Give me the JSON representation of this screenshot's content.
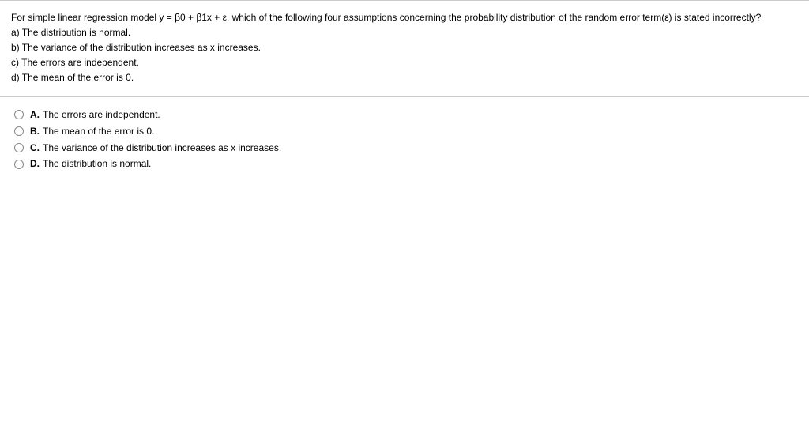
{
  "question": {
    "prompt": "For simple linear regression model  y = β0 + β1x + ε,  which of the following four assumptions concerning the probability distribution of the random error term(ε) is stated incorrectly?",
    "subparts": [
      "a) The distribution is normal.",
      "b) The variance of the distribution increases as x increases.",
      "c) The errors are independent.",
      "d)   The mean of the error is 0."
    ]
  },
  "answers": [
    {
      "letter": "A.",
      "text": "The errors are independent."
    },
    {
      "letter": "B.",
      "text": "The mean of the error is 0."
    },
    {
      "letter": "C.",
      "text": "The variance of the distribution increases as x increases."
    },
    {
      "letter": "D.",
      "text": "The distribution is normal."
    }
  ]
}
